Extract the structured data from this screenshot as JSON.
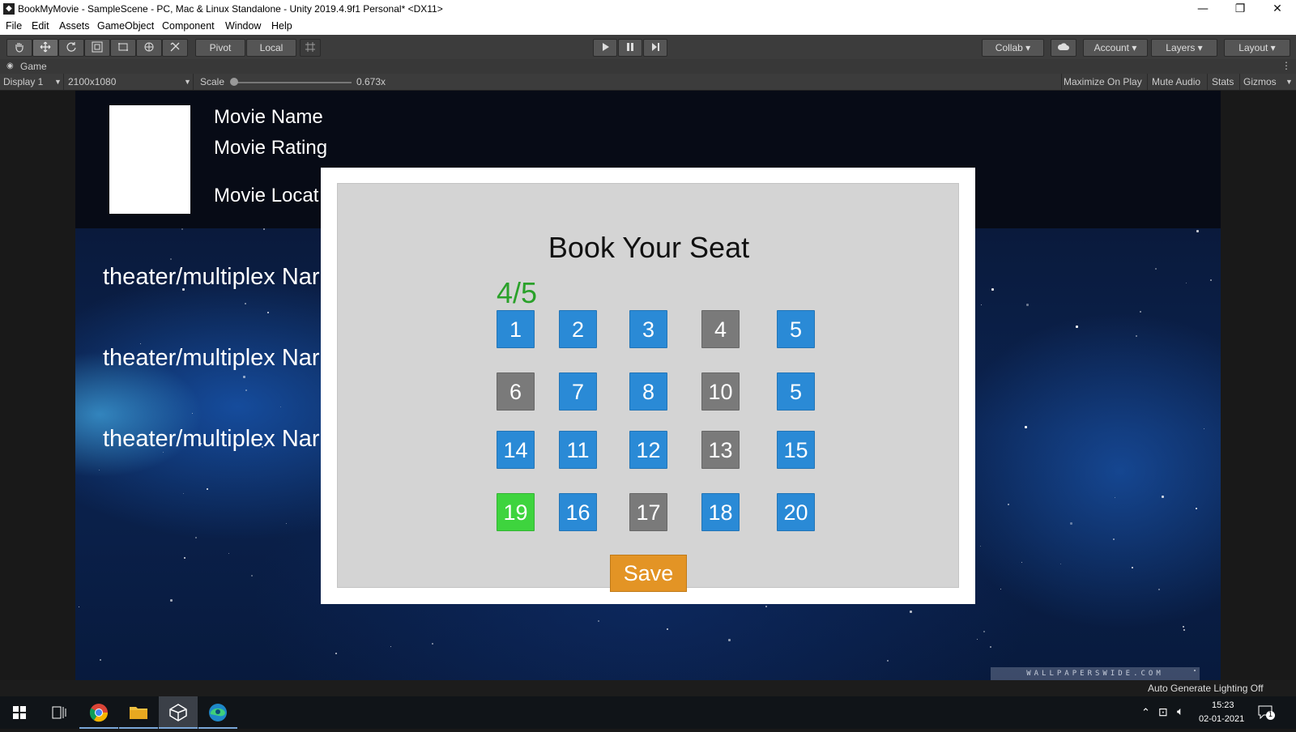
{
  "window": {
    "title": "BookMyMovie - SampleScene - PC, Mac & Linux Standalone - Unity 2019.4.9f1 Personal* <DX11>",
    "minimize": "—",
    "maximize": "❐",
    "close": "✕"
  },
  "menu": [
    "File",
    "Edit",
    "Assets",
    "GameObject",
    "Component",
    "Window",
    "Help"
  ],
  "toolbar": {
    "pivot": "Pivot",
    "local": "Local",
    "collab": "Collab",
    "account": "Account",
    "layers": "Layers",
    "layout": "Layout"
  },
  "game_tab": {
    "label": "Game",
    "display": "Display 1",
    "resolution": "2100x1080",
    "scale_label": "Scale",
    "scale_value": "0.673x",
    "scale_fraction": 0.0,
    "maximize_on_play": "Maximize On Play",
    "mute_audio": "Mute Audio",
    "stats": "Stats",
    "gizmos": "Gizmos"
  },
  "movie": {
    "name": "Movie Name",
    "rating": "Movie Rating",
    "location": "Movie Locat"
  },
  "theaters": [
    "theater/multiplex Nar",
    "theater/multiplex Nar",
    "theater/multiplex Nar"
  ],
  "watermark": "WALLPAPERSWIDE.COM",
  "booking": {
    "title": "Book Your Seat",
    "counter": "4/5",
    "save_label": "Save",
    "seat_rows": [
      [
        {
          "label": "1",
          "state": "available"
        },
        {
          "label": "2",
          "state": "available"
        },
        {
          "label": "3",
          "state": "available"
        },
        {
          "label": "4",
          "state": "booked"
        },
        {
          "label": "5",
          "state": "available"
        }
      ],
      [
        {
          "label": "6",
          "state": "booked"
        },
        {
          "label": "7",
          "state": "available"
        },
        {
          "label": "8",
          "state": "available"
        },
        {
          "label": "10",
          "state": "booked"
        },
        {
          "label": "5",
          "state": "available"
        }
      ],
      [
        {
          "label": "14",
          "state": "available"
        },
        {
          "label": "11",
          "state": "available"
        },
        {
          "label": "12",
          "state": "available"
        },
        {
          "label": "13",
          "state": "booked"
        },
        {
          "label": "15",
          "state": "available"
        }
      ],
      [
        {
          "label": "19",
          "state": "selected"
        },
        {
          "label": "16",
          "state": "available"
        },
        {
          "label": "17",
          "state": "booked"
        },
        {
          "label": "18",
          "state": "available"
        },
        {
          "label": "20",
          "state": "available"
        }
      ]
    ],
    "colors": {
      "available": "#2a8ad6",
      "booked": "#7a7a7a",
      "selected": "#3ed43e",
      "save": "#e39425",
      "counter": "#2aa12a"
    }
  },
  "status": {
    "lighting": "Auto Generate Lighting Off"
  },
  "taskbar": {
    "time": "15:23",
    "date": "02-01-2021",
    "notification_count": "1"
  }
}
